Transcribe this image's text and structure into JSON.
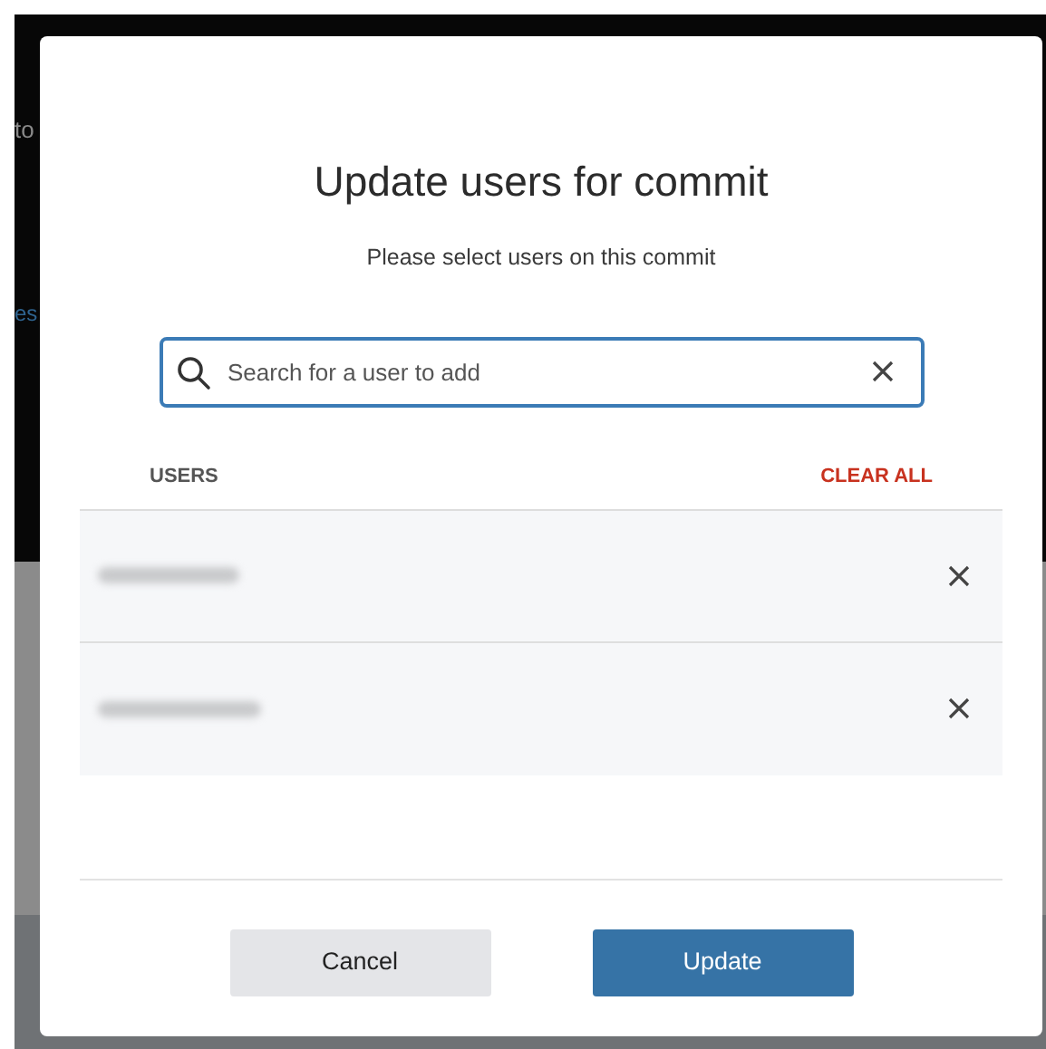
{
  "background_page": {
    "fragments": [
      {
        "text": "to",
        "kind": "plain"
      },
      {
        "text": "es",
        "kind": "link"
      }
    ]
  },
  "dialog": {
    "title": "Update users for commit",
    "subtitle": "Please select users on this commit",
    "search": {
      "placeholder": "Search for a user to add"
    },
    "users_header": "USERS",
    "clear_all": "CLEAR ALL",
    "users": [
      {
        "name_redacted": true
      },
      {
        "name_redacted": true
      }
    ],
    "buttons": [
      {
        "label": "Cancel",
        "kind": "secondary"
      },
      {
        "label": "Update",
        "kind": "primary"
      }
    ]
  }
}
